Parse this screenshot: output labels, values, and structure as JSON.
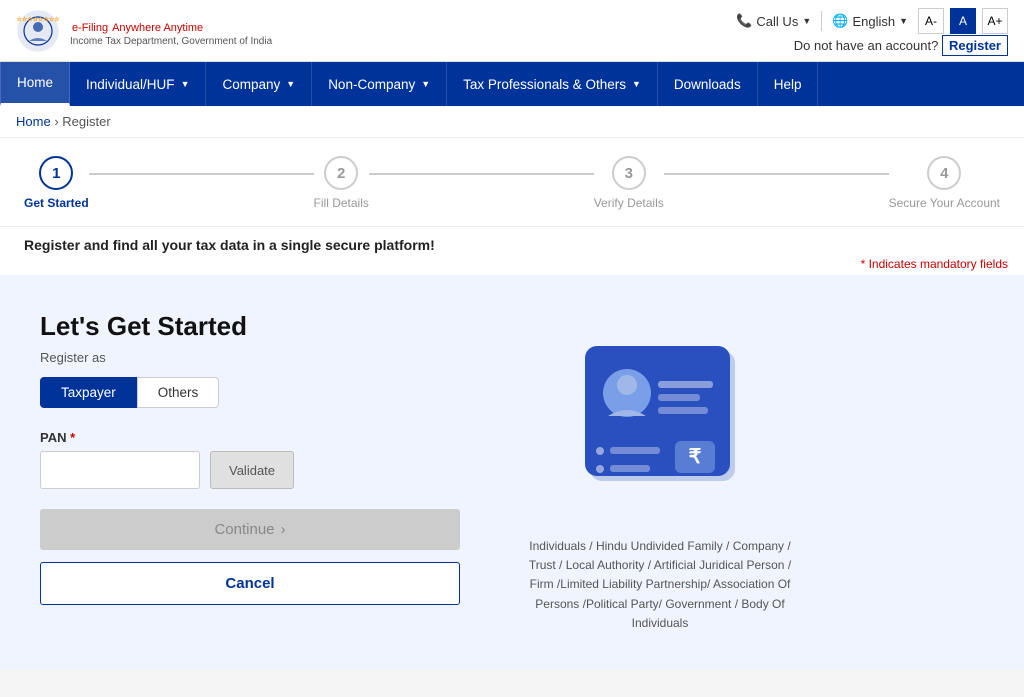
{
  "topbar": {
    "logo_title": "e-Filing",
    "logo_tagline": "Anywhere Anytime",
    "logo_subtitle": "Income Tax Department, Government of India",
    "call_us_label": "Call Us",
    "language_label": "English",
    "font_decrease_label": "A-",
    "font_default_label": "A",
    "font_increase_label": "A+",
    "register_notice": "Do not have an account?",
    "register_link_label": "Register"
  },
  "navbar": {
    "items": [
      {
        "label": "Home",
        "active": true,
        "has_caret": false
      },
      {
        "label": "Individual/HUF",
        "active": false,
        "has_caret": true
      },
      {
        "label": "Company",
        "active": false,
        "has_caret": true
      },
      {
        "label": "Non-Company",
        "active": false,
        "has_caret": true
      },
      {
        "label": "Tax Professionals & Others",
        "active": false,
        "has_caret": true
      },
      {
        "label": "Downloads",
        "active": false,
        "has_caret": false
      },
      {
        "label": "Help",
        "active": false,
        "has_caret": false
      }
    ]
  },
  "breadcrumb": {
    "home_label": "Home",
    "current_label": "Register"
  },
  "stepper": {
    "steps": [
      {
        "number": "1",
        "label": "Get Started",
        "active": true
      },
      {
        "number": "2",
        "label": "Fill Details",
        "active": false
      },
      {
        "number": "3",
        "label": "Verify Details",
        "active": false
      },
      {
        "number": "4",
        "label": "Secure Your Account",
        "active": false
      }
    ]
  },
  "tagline": {
    "text": "Register and find all your tax data in a single secure platform!",
    "mandatory_note": "* Indicates mandatory fields"
  },
  "form": {
    "heading": "Let's Get Started",
    "register_as_label": "Register as",
    "toggle_taxpayer": "Taxpayer",
    "toggle_others": "Others",
    "pan_label": "PAN",
    "pan_required": "*",
    "pan_placeholder": "",
    "validate_label": "Validate",
    "continue_label": "Continue",
    "continue_arrow": "›",
    "cancel_label": "Cancel"
  },
  "illustration": {
    "caption": "Individuals / Hindu Undivided Family / Company / Trust / Local Authority / Artificial Juridical Person / Firm /Limited Liability Partnership/ Association Of Persons /Political Party/ Government / Body Of Individuals"
  },
  "colors": {
    "primary": "#003399",
    "danger": "#cc0000",
    "disabled_bg": "#cccccc",
    "disabled_text": "#888888"
  }
}
